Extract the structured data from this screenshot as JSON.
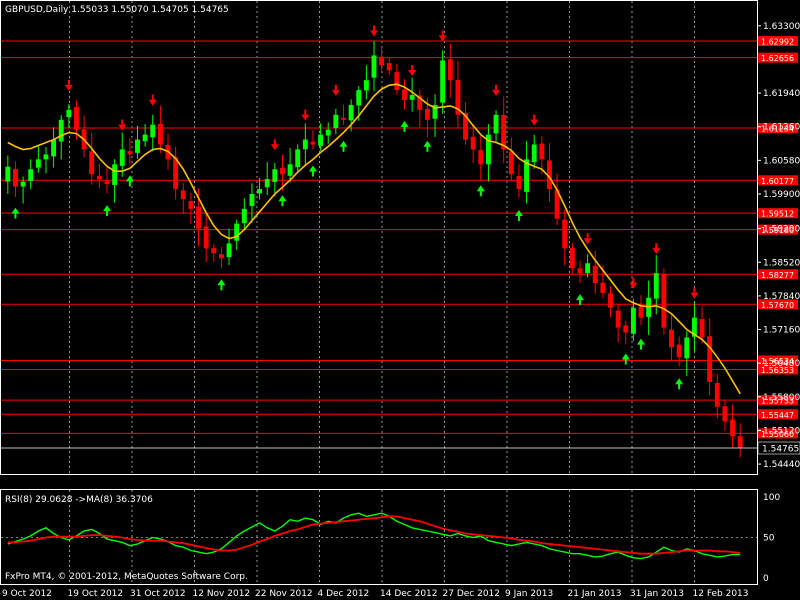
{
  "header": {
    "symbol_line": "GBPUSD,Daily  1.55033 1.55070 1.54705 1.54765"
  },
  "indicator": {
    "title": "RSI(8) 29.0628  ->MA(8) 36.3706"
  },
  "footer": {
    "copyright": "FxPro MT4, © 2001-2012, MetaQuotes Software Corp."
  },
  "colors": {
    "background": "#000000",
    "frame": "#ffffff",
    "up_candle": "#00ff00",
    "down_candle": "#ff0000",
    "moving_average": "#ffc000",
    "level_lines": "#ff0000",
    "buy_arrow": "#00ff00",
    "sell_arrow": "#ff0000",
    "rsi_line": "#00ff00",
    "rsi_ma_line": "#ff0000",
    "current_price_line": "#ffffff"
  },
  "chart_data": [
    {
      "type": "candlestick",
      "title": "GBPUSD,Daily",
      "ohlc_last": {
        "open": 1.55033,
        "high": 1.5507,
        "low": 1.54705,
        "close": 1.54765
      },
      "ylim": [
        1.5428,
        1.637
      ],
      "y_ticks": [
        "1.63300",
        "1.61940",
        "1.61260",
        "1.60580",
        "1.59900",
        "1.59200",
        "1.58520",
        "1.57840",
        "1.57160",
        "1.56480",
        "1.55800",
        "1.55120",
        "1.54440"
      ],
      "x_ticks": [
        "9 Oct 2012",
        "19 Oct 2012",
        "31 Oct 2012",
        "12 Nov 2012",
        "22 Nov 2012",
        "4 Dec 2012",
        "14 Dec 2012",
        "27 Dec 2012",
        "9 Jan 2013",
        "21 Jan 2013",
        "31 Jan 2013",
        "12 Feb 2013"
      ],
      "level_lines": [
        "1.62992",
        "1.62656",
        "1.61234",
        "1.60177",
        "1.59512",
        "1.59180",
        "1.58277",
        "1.57670",
        "1.56534",
        "1.56353",
        "1.55733",
        "1.55447",
        "1.55060"
      ],
      "current_price": "1.54765",
      "close": [
        1.6045,
        1.6005,
        1.6015,
        1.604,
        1.606,
        1.607,
        1.61,
        1.614,
        1.616,
        1.612,
        1.608,
        1.603,
        1.602,
        1.601,
        1.605,
        1.608,
        1.607,
        1.61,
        1.611,
        1.613,
        1.609,
        1.606,
        1.6,
        1.598,
        1.596,
        1.592,
        1.588,
        1.587,
        1.586,
        1.589,
        1.593,
        1.596,
        1.599,
        1.6,
        1.602,
        1.604,
        1.603,
        1.605,
        1.608,
        1.61,
        1.609,
        1.611,
        1.612,
        1.615,
        1.614,
        1.617,
        1.62,
        1.622,
        1.627,
        1.625,
        1.624,
        1.62,
        1.618,
        1.619,
        1.616,
        1.614,
        1.617,
        1.626,
        1.622,
        1.615,
        1.61,
        1.608,
        1.605,
        1.611,
        1.615,
        1.608,
        1.603,
        1.6,
        1.606,
        1.609,
        1.606,
        1.6,
        1.594,
        1.588,
        1.584,
        1.583,
        1.585,
        1.581,
        1.579,
        1.576,
        1.572,
        1.571,
        1.576,
        1.574,
        1.578,
        1.583,
        1.572,
        1.568,
        1.566,
        1.57,
        1.574,
        1.57,
        1.561,
        1.556,
        1.553,
        1.55,
        1.5477
      ],
      "moving_average_values": [
        1.6094,
        1.6086,
        1.608,
        1.6082,
        1.6088,
        1.6094,
        1.61,
        1.6108,
        1.6114,
        1.6112,
        1.61,
        1.6082,
        1.6062,
        1.6046,
        1.6036,
        1.6036,
        1.6042,
        1.6056,
        1.607,
        1.608,
        1.6082,
        1.6076,
        1.6062,
        1.604,
        1.6012,
        1.5982,
        1.5952,
        1.5926,
        1.5908,
        1.59,
        1.5904,
        1.5918,
        1.5936,
        1.5954,
        1.5972,
        1.599,
        1.6004,
        1.6018,
        1.6034,
        1.6048,
        1.606,
        1.6074,
        1.6086,
        1.61,
        1.6114,
        1.613,
        1.6148,
        1.6168,
        1.6188,
        1.6202,
        1.621,
        1.6212,
        1.6206,
        1.6196,
        1.6184,
        1.6172,
        1.6164,
        1.6166,
        1.6168,
        1.6162,
        1.6148,
        1.6128,
        1.611,
        1.6098,
        1.6094,
        1.6088,
        1.6078,
        1.6062,
        1.6052,
        1.6046,
        1.604,
        1.6024,
        1.5998,
        1.5966,
        1.5932,
        1.5902,
        1.5878,
        1.5856,
        1.5836,
        1.5816,
        1.5796,
        1.5778,
        1.577,
        1.5764,
        1.5762,
        1.5764,
        1.5758,
        1.5748,
        1.5732,
        1.5716,
        1.5706,
        1.5696,
        1.568,
        1.566,
        1.5638,
        1.5612,
        1.5586
      ]
    },
    {
      "type": "line",
      "title": "RSI(8) 29.0628  ->MA(8) 36.3706",
      "ylim": [
        0,
        100
      ],
      "y_ticks": [
        "100",
        "50",
        "0"
      ],
      "series": [
        {
          "name": "RSI(8)",
          "values": [
            42,
            45,
            48,
            52,
            58,
            62,
            55,
            50,
            47,
            52,
            58,
            60,
            55,
            48,
            46,
            44,
            40,
            42,
            46,
            50,
            48,
            45,
            40,
            38,
            34,
            32,
            30,
            32,
            36,
            44,
            52,
            58,
            63,
            68,
            62,
            58,
            64,
            72,
            70,
            74,
            72,
            66,
            70,
            68,
            74,
            78,
            80,
            76,
            78,
            80,
            76,
            70,
            66,
            62,
            60,
            58,
            56,
            54,
            52,
            55,
            52,
            50,
            52,
            46,
            44,
            42,
            40,
            42,
            44,
            42,
            40,
            36,
            34,
            32,
            30,
            30,
            28,
            26,
            27,
            30,
            32,
            28,
            25,
            24,
            26,
            32,
            38,
            34,
            32,
            36,
            34,
            30,
            28,
            26,
            27,
            29,
            29
          ]
        },
        {
          "name": "MA(8)",
          "values": [
            44,
            44,
            45,
            46,
            48,
            50,
            51,
            51,
            51,
            51,
            52,
            53,
            53,
            52,
            51,
            50,
            48,
            47,
            46,
            46,
            46,
            45,
            44,
            43,
            41,
            39,
            37,
            35,
            34,
            34,
            35,
            38,
            41,
            45,
            48,
            52,
            55,
            58,
            60,
            63,
            66,
            67,
            68,
            69,
            70,
            71,
            72,
            73,
            74,
            75,
            76,
            76,
            74,
            72,
            70,
            67,
            64,
            61,
            59,
            57,
            55,
            54,
            53,
            52,
            51,
            50,
            49,
            47,
            46,
            45,
            43,
            42,
            41,
            40,
            39,
            38,
            37,
            36,
            35,
            34,
            33,
            32,
            31,
            30,
            30,
            30,
            31,
            32,
            33,
            34,
            34,
            34,
            34,
            33,
            33,
            32,
            31
          ]
        }
      ]
    }
  ]
}
